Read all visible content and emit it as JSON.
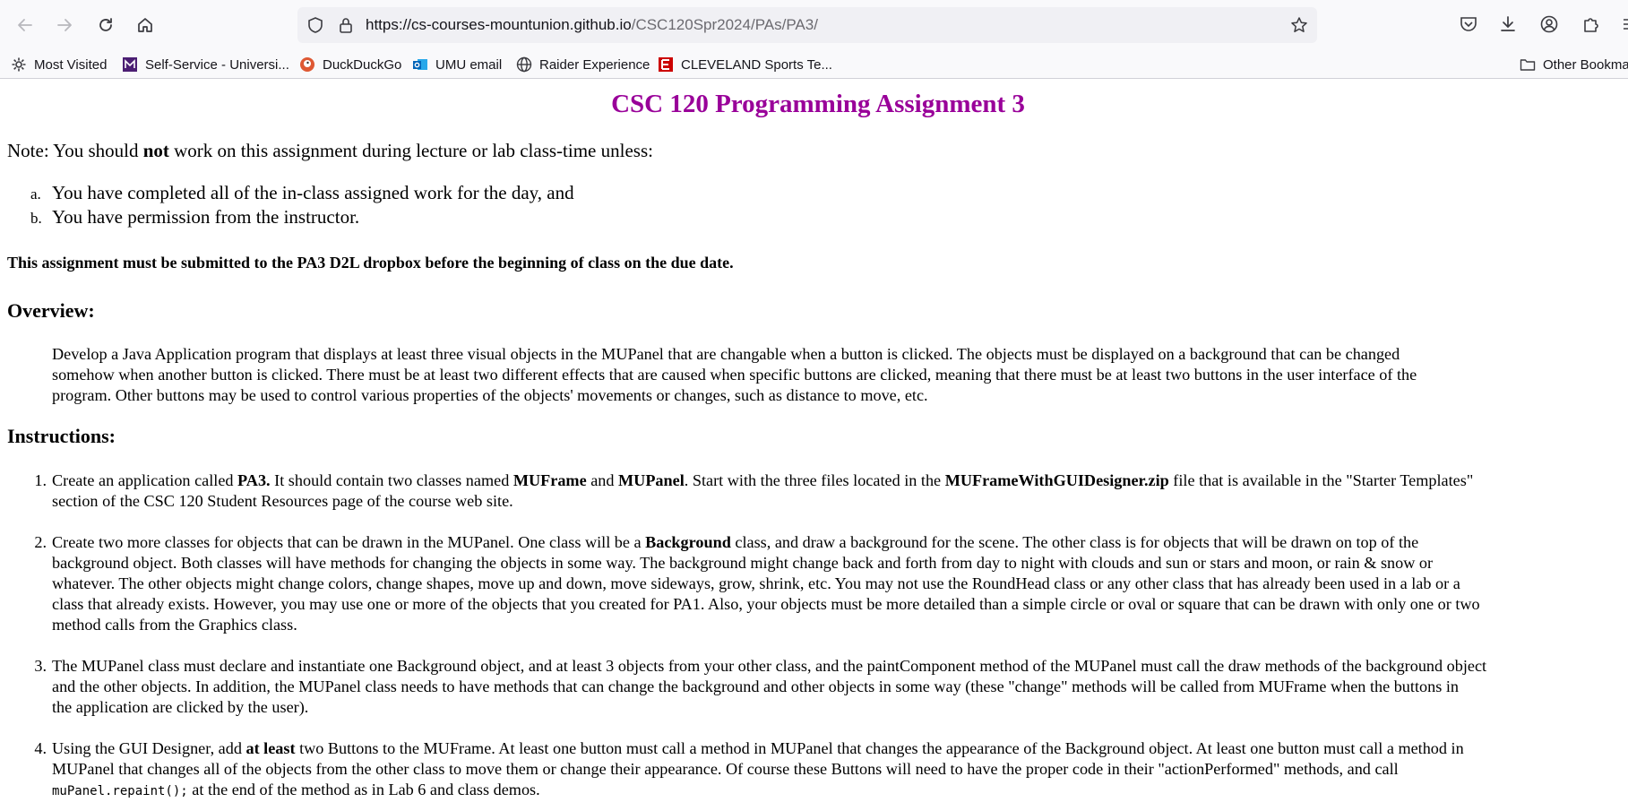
{
  "browser": {
    "url_host": "https://cs-courses-mountunion.github.io",
    "url_path": "/CSC120Spr2024/PAs/PA3/",
    "bookmarks": [
      {
        "label": "Most Visited",
        "icon": "gear-icon"
      },
      {
        "label": "Self-Service - Universi...",
        "icon": "m-logo-icon"
      },
      {
        "label": "DuckDuckGo",
        "icon": "duckduckgo-icon"
      },
      {
        "label": "UMU email",
        "icon": "outlook-icon"
      },
      {
        "label": "Raider Experience",
        "icon": "globe-icon"
      },
      {
        "label": "CLEVELAND Sports Te...",
        "icon": "espn-icon"
      }
    ],
    "other_bookmarks": "Other Bookmarks"
  },
  "page": {
    "title": "CSC 120 Programming Assignment 3",
    "note_prefix": "Note: You should ",
    "note_bold": "not",
    "note_suffix": " work on this assignment during lecture or lab class-time unless:",
    "conditions": [
      {
        "marker": "a.",
        "text": "You have completed all of the in-class assigned work for the day, and"
      },
      {
        "marker": "b.",
        "text": "You have permission from the instructor."
      }
    ],
    "submission": "This assignment must be submitted to the PA3 D2L dropbox before the beginning of class on the due date.",
    "overview_heading": "Overview:",
    "overview_line1": "Develop a Java Application program that displays at least three visual objects in the MUPanel that are changable when a button is clicked.  The objects must be displayed on a background that can be changed",
    "overview_line2": "somehow when another button is clicked.  There must be at least two different effects that are caused when specific buttons are clicked, meaning that there must be at least two buttons in the user interface of the",
    "overview_line3": "program. Other buttons may be used to control various properties of the objects' movements or changes, such as distance to move, etc.",
    "instructions_heading": "Instructions:",
    "steps": {
      "s1": {
        "num": "1.",
        "a": "Create an application called ",
        "b": "PA3.",
        "c": " It should contain two classes named ",
        "d": "MUFrame",
        "e": " and ",
        "f": "MUPanel",
        "g": ".  Start with the three files located in the ",
        "h": "MUFrameWithGUIDesigner.zip",
        "i": " file that is available in the \"Starter Templates\"",
        "line2": "section of the CSC 120 Student Resources page of the course web site."
      },
      "s2": {
        "num": "2.",
        "a": "Create two more classes for objects that can be drawn in the MUPanel. One class will be a ",
        "b": "Background",
        "c": " class, and draw a background for the scene. The other class is for objects that will be drawn on top of the",
        "line2": "background object. Both classes will have methods for changing the objects in some way. The background might change back and forth from day to night with clouds and sun or stars and moon, or rain & snow or",
        "line3": "whatever. The other objects might change colors, change shapes, move up and down, move sideways, grow, shrink, etc. You may not use the RoundHead class or any other class that has already been used in a lab or a",
        "line4": "class that already exists. However, you may use one or more of the objects that you created for PA1. Also, your objects must be more detailed than a simple circle or oval or square that can be drawn with only one or two",
        "line5": "method calls from the Graphics class."
      },
      "s3": {
        "num": "3.",
        "line1": "The MUPanel class must declare and instantiate one Background object, and at least 3 objects from your other class, and the paintComponent method of the MUPanel must call the draw methods of the background object",
        "line2": "and the other objects.  In addition, the MUPanel class needs to have methods that can change the background and other objects in some way (these \"change\" methods will be called from MUFrame when the buttons in",
        "line3": "the application are clicked by the user)."
      },
      "s4": {
        "num": "4.",
        "a": "Using the GUI Designer, add ",
        "b": "at least",
        "c": " two Buttons to the MUFrame. At least one button must call a method in MUPanel that changes the appearance of the Background object. At least one button must call a method in",
        "line2": "MUPanel that changes all of the objects from the other class to move them or change their appearance. Of course these Buttons will need to have the proper code in their \"actionPerformed\" methods, and call",
        "code": "muPanel.repaint();",
        "line3_suffix": " at the end of the method as in Lab 6 and class demos."
      }
    }
  },
  "colors": {
    "title": "#990099",
    "chrome_bg": "#f9f9fb",
    "urlbar_bg": "#f0f0f4"
  }
}
